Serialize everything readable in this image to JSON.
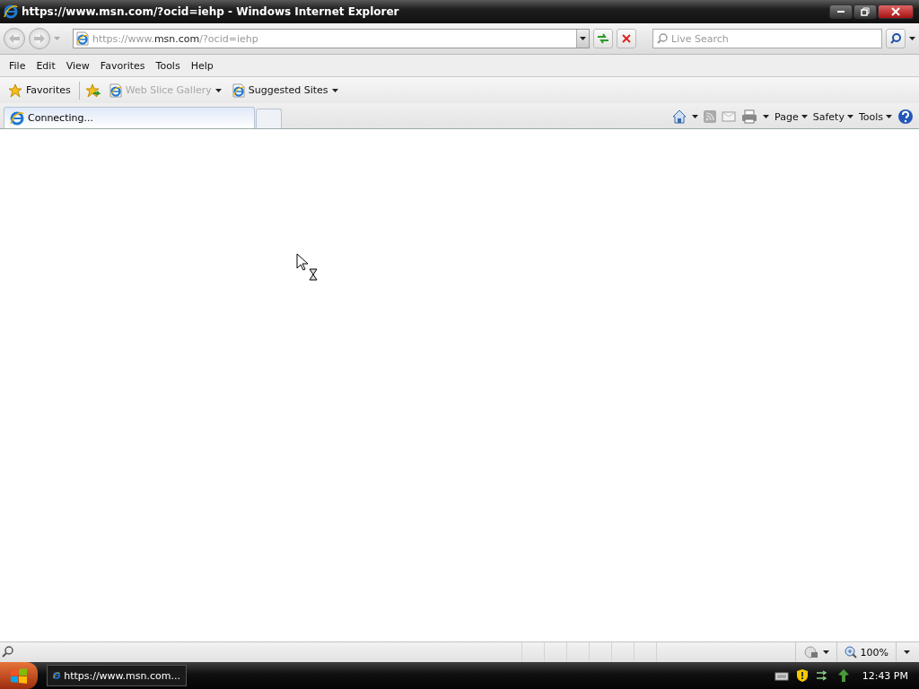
{
  "window": {
    "title": "https://www.msn.com/?ocid=iehp - Windows Internet Explorer"
  },
  "address_bar": {
    "url_parts": [
      {
        "text": "https://www.",
        "emphasis": false
      },
      {
        "text": "msn.com",
        "emphasis": true
      },
      {
        "text": "/?ocid=iehp",
        "emphasis": false
      }
    ]
  },
  "search": {
    "placeholder": "Live Search"
  },
  "menu": [
    "File",
    "Edit",
    "View",
    "Favorites",
    "Tools",
    "Help"
  ],
  "favorites_bar": {
    "favorites_label": "Favorites",
    "items": [
      {
        "label": "Web Slice Gallery",
        "disabled": true
      },
      {
        "label": "Suggested Sites",
        "disabled": false
      }
    ]
  },
  "tabs": [
    {
      "label": "Connecting...",
      "selected": true
    }
  ],
  "command_bar": [
    "Page",
    "Safety",
    "Tools"
  ],
  "status_bar": {
    "zoom": "100%"
  },
  "taskbar": {
    "items": [
      {
        "label": "https://www.msn.com...",
        "selected": false
      }
    ],
    "clock": "12:43 PM"
  }
}
